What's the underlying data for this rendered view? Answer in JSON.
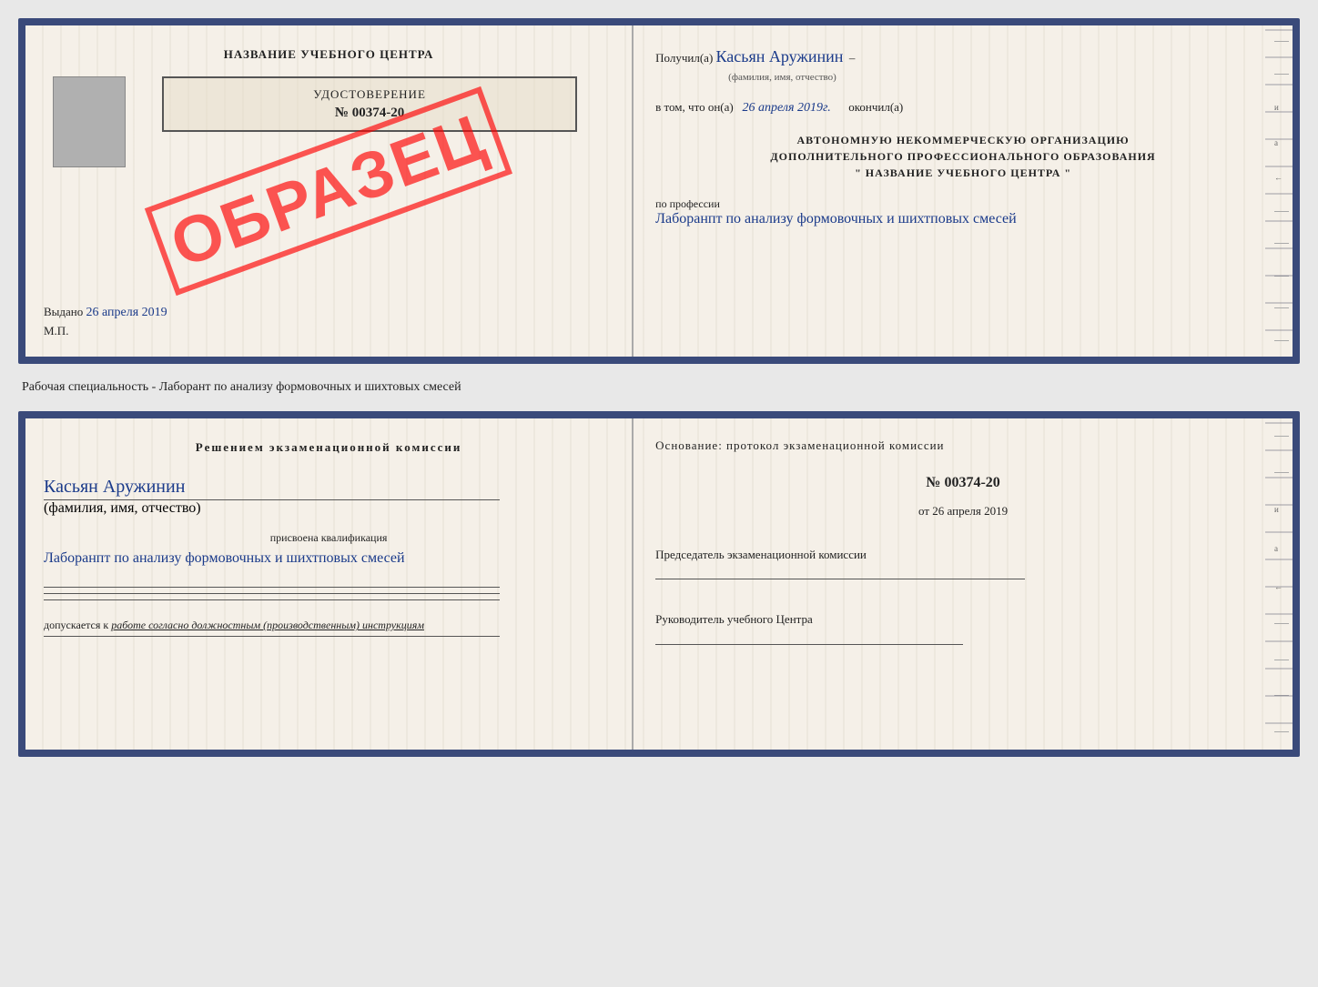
{
  "page": {
    "background": "#e8e8e8"
  },
  "doc1": {
    "left": {
      "title": "НАЗВАНИЕ УЧЕБНОГО ЦЕНТРА",
      "certificate_label": "УДОСТОВЕРЕНИЕ",
      "certificate_number": "№ 00374-20",
      "stamp": "ОБРАЗЕЦ",
      "issued_label": "Выдано",
      "issued_date": "26 апреля 2019",
      "mp_label": "М.П."
    },
    "right": {
      "received_label": "Получил(а)",
      "received_name": "Касьян Аружинин",
      "name_subtitle": "(фамилия, имя, отчество)",
      "completed_prefix": "в том, что он(а)",
      "completed_date": "26 апреля 2019г.",
      "completed_suffix": "окончил(а)",
      "org_line1": "АВТОНОМНУЮ НЕКОММЕРЧЕСКУЮ ОРГАНИЗАЦИЮ",
      "org_line2": "ДОПОЛНИТЕЛЬНОГО ПРОФЕССИОНАЛЬНОГО ОБРАЗОВАНИЯ",
      "org_line3": "\"   НАЗВАНИЕ УЧЕБНОГО ЦЕНТРА   \"",
      "profession_label": "по профессии",
      "profession_handwritten": "Лаборанпт по анализу формовочных и шихтповых смесей"
    }
  },
  "between": {
    "text": "Рабочая специальность - Лаборант по анализу формовочных и шихтовых смесей"
  },
  "doc2": {
    "left": {
      "decision_label": "Решением экзаменационной комиссии",
      "person_name": "Касьян Аружинин",
      "name_subtitle": "(фамилия, имя, отчество)",
      "qualification_label": "присвоена квалификация",
      "qualification_handwritten": "Лаборанпт по анализу формовочных и шихтповых смесей",
      "admission_label": "допускается к",
      "admission_text": "работе согласно должностным (производственным) инструкциям"
    },
    "right": {
      "basis_label": "Основание: протокол экзаменационной комиссии",
      "protocol_number": "№ 00374-20",
      "protocol_date_prefix": "от",
      "protocol_date": "26 апреля 2019",
      "chairman_label": "Председатель экзаменационной комиссии",
      "director_label": "Руководитель учебного Центра"
    }
  }
}
